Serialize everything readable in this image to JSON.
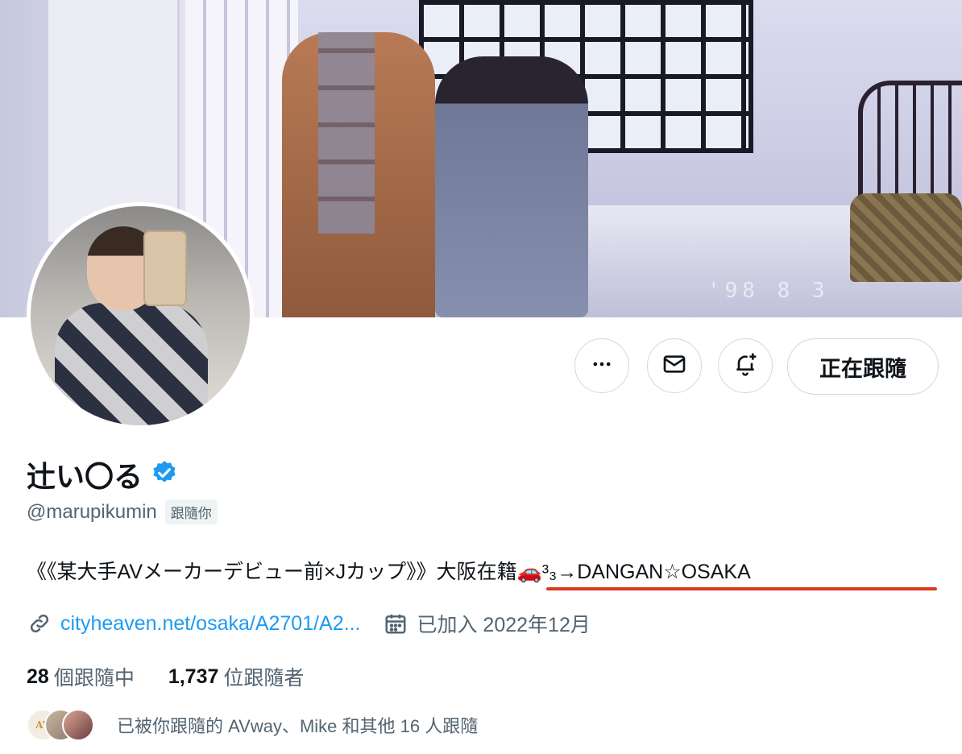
{
  "profile": {
    "display_name": "辻い〇る",
    "verified_icon": "verified-badge-icon",
    "handle": "@marupikumin",
    "follows_you_badge": "跟隨你",
    "bio": "《《某大手AVメーカーデビュー前×Jカップ》》大阪在籍🚗³₃→DANGAN☆OSAKA",
    "website": "cityheaven.net/osaka/A2701/A2...",
    "joined": "已加入 2022年12月",
    "following_count": "28",
    "following_label": "個跟隨中",
    "followers_count": "1,737",
    "followers_label": "位跟隨者",
    "followed_by_text": "已被你跟隨的 AVway、Mike 和其他 16 人跟隨",
    "followed_by_avatar_text": "AV"
  },
  "banner": {
    "stamp_text": "'98 8 3"
  },
  "actions": {
    "more_icon": "more-horizontal-icon",
    "message_icon": "envelope-icon",
    "notify_icon": "bell-plus-icon",
    "follow_label": "正在跟隨"
  },
  "colors": {
    "link": "#1d9bf0",
    "verified": "#1d9bf0",
    "secondary_text": "#536471",
    "highlight_underline": "#d9391e"
  }
}
